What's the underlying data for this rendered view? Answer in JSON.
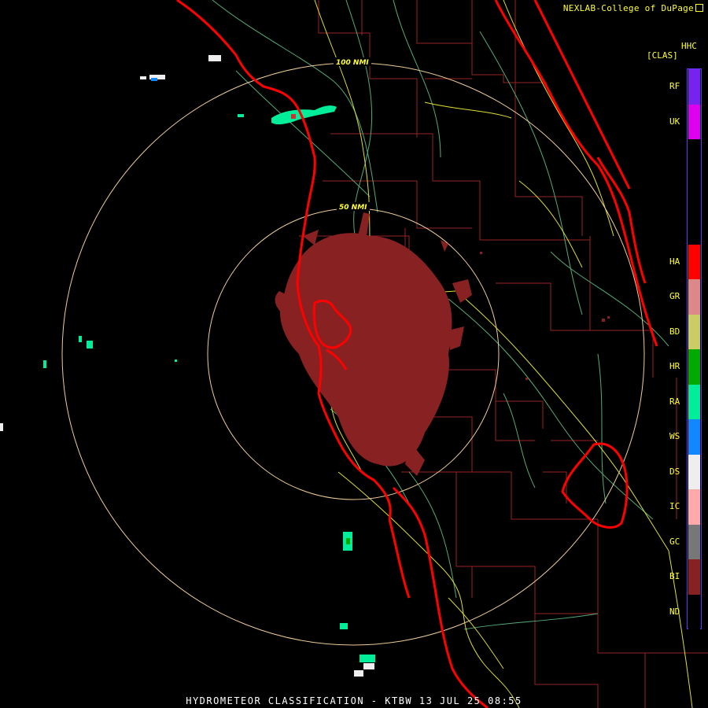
{
  "header": {
    "credit": "NEXLAB-College of DuPage",
    "product_code": "HHC",
    "product_class": "[CLAS]"
  },
  "range_rings": [
    {
      "label": "50 NMI"
    },
    {
      "label": "100 NMI"
    }
  ],
  "legend": [
    {
      "code": "RF",
      "color": "#7722ee"
    },
    {
      "code": "UK",
      "color": "#dd00ee"
    },
    {
      "code": "HA",
      "color": "#ff0000"
    },
    {
      "code": "GR",
      "color": "#dd8888"
    },
    {
      "code": "BD",
      "color": "#cccc66"
    },
    {
      "code": "HR",
      "color": "#00aa00"
    },
    {
      "code": "RA",
      "color": "#00ee99"
    },
    {
      "code": "WS",
      "color": "#1188ff"
    },
    {
      "code": "DS",
      "color": "#eeeeee"
    },
    {
      "code": "IC",
      "color": "#ffaaaa"
    },
    {
      "code": "GC",
      "color": "#777777"
    },
    {
      "code": "BI",
      "color": "#882222"
    },
    {
      "code": "ND",
      "color": "#000000"
    }
  ],
  "footer": "HYDROMETEOR CLASSIFICATION - KTBW 13 JUL 25 08:55",
  "colors": {
    "coastline": "#ff0000",
    "county_lines": "#992222",
    "highways": "#dddd33",
    "roads": "#66bb88",
    "range_ring": "#eecc99"
  }
}
